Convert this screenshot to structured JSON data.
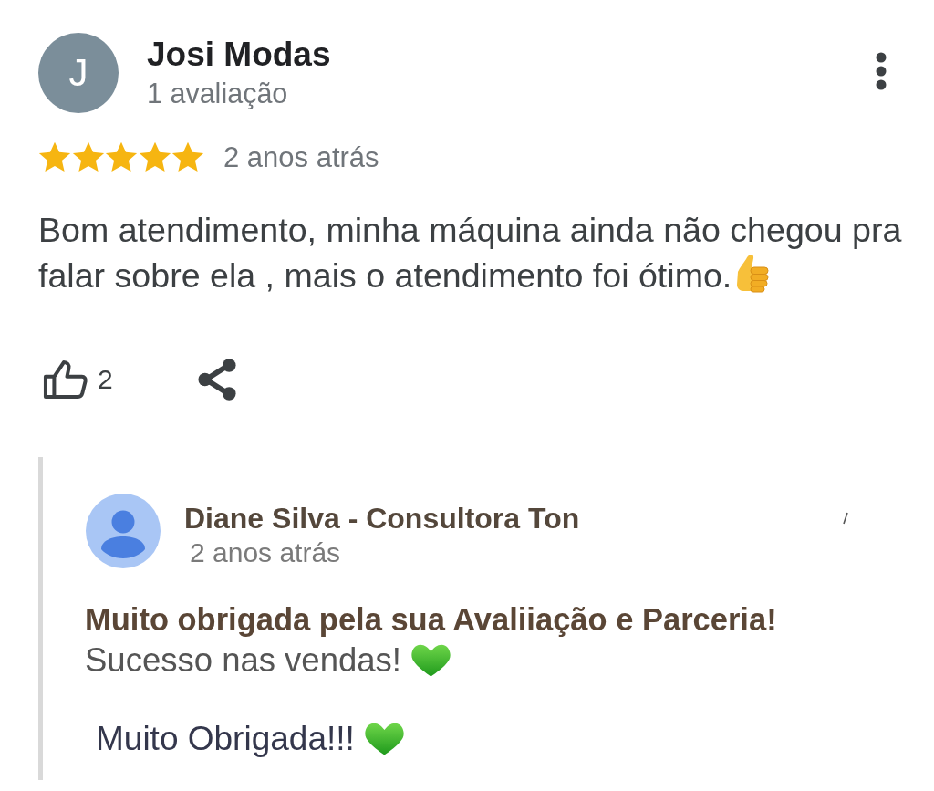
{
  "review": {
    "author": {
      "initial": "J",
      "name": "Josi Modas",
      "review_count": "1 avaliação"
    },
    "stars": 5,
    "time": "2 anos atrás",
    "text": "Bom atendimento, minha máquina ainda não chegou pra falar sobre ela , mais o atendimento foi ótimo.",
    "emoji": true,
    "likes": "2"
  },
  "reply": {
    "author": "Diane Silva - Consultora Ton",
    "time": "2 anos atrás",
    "lines": [
      {
        "kind": "title",
        "text": "Muito obrigada pela sua Avaliiação e Parceria!",
        "emoji": false
      },
      {
        "kind": "message",
        "text": "Sucesso nas vendas!",
        "emoji": true
      },
      {
        "kind": "closing",
        "text": "Muito Obrigada!!!",
        "emoji": true
      }
    ]
  }
}
